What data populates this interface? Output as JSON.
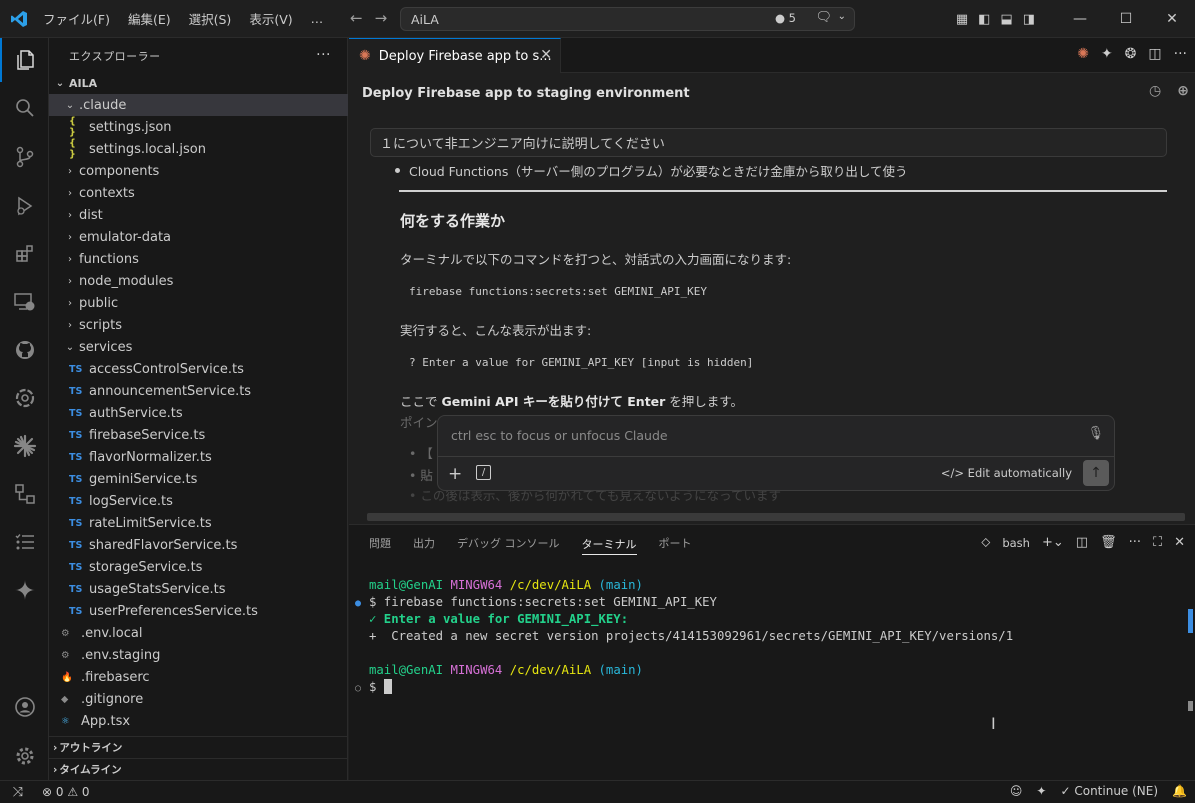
{
  "titlebar": {
    "menus": [
      "ファイル(F)",
      "編集(E)",
      "選択(S)",
      "表示(V)",
      "…"
    ],
    "search_text": "AiLA",
    "badge_count": "● 5"
  },
  "sidebar": {
    "header": "エクスプローラー",
    "root": "AILA",
    "items": [
      {
        "label": ".claude",
        "kind": "folder-open",
        "depth": 1,
        "selected": true
      },
      {
        "label": "settings.json",
        "kind": "json",
        "depth": 2
      },
      {
        "label": "settings.local.json",
        "kind": "json",
        "depth": 2
      },
      {
        "label": "components",
        "kind": "folder",
        "depth": 1
      },
      {
        "label": "contexts",
        "kind": "folder",
        "depth": 1
      },
      {
        "label": "dist",
        "kind": "folder",
        "depth": 1
      },
      {
        "label": "emulator-data",
        "kind": "folder",
        "depth": 1
      },
      {
        "label": "functions",
        "kind": "folder",
        "depth": 1
      },
      {
        "label": "node_modules",
        "kind": "folder",
        "depth": 1
      },
      {
        "label": "public",
        "kind": "folder",
        "depth": 1
      },
      {
        "label": "scripts",
        "kind": "folder",
        "depth": 1
      },
      {
        "label": "services",
        "kind": "folder-open",
        "depth": 1
      },
      {
        "label": "accessControlService.ts",
        "kind": "ts",
        "depth": 2
      },
      {
        "label": "announcementService.ts",
        "kind": "ts",
        "depth": 2
      },
      {
        "label": "authService.ts",
        "kind": "ts",
        "depth": 2
      },
      {
        "label": "firebaseService.ts",
        "kind": "ts",
        "depth": 2
      },
      {
        "label": "flavorNormalizer.ts",
        "kind": "ts",
        "depth": 2
      },
      {
        "label": "geminiService.ts",
        "kind": "ts",
        "depth": 2
      },
      {
        "label": "logService.ts",
        "kind": "ts",
        "depth": 2
      },
      {
        "label": "rateLimitService.ts",
        "kind": "ts",
        "depth": 2
      },
      {
        "label": "sharedFlavorService.ts",
        "kind": "ts",
        "depth": 2
      },
      {
        "label": "storageService.ts",
        "kind": "ts",
        "depth": 2
      },
      {
        "label": "usageStatsService.ts",
        "kind": "ts",
        "depth": 2
      },
      {
        "label": "userPreferencesService.ts",
        "kind": "ts",
        "depth": 2
      },
      {
        "label": ".env.local",
        "kind": "gear",
        "depth": 1
      },
      {
        "label": ".env.staging",
        "kind": "gear",
        "depth": 1
      },
      {
        "label": ".firebaserc",
        "kind": "fire",
        "depth": 1
      },
      {
        "label": ".gitignore",
        "kind": "git",
        "depth": 1
      },
      {
        "label": "App.tsx",
        "kind": "react",
        "depth": 1
      }
    ],
    "outline": "アウトライン",
    "timeline": "タイムライン"
  },
  "editor": {
    "tab_label": "Deploy Firebase app to s...",
    "panel_title": "Deploy Firebase app to staging environment",
    "question": "１について非エンジニア向けに説明してください",
    "bullet": "Cloud Functions（サーバー側のプログラム）が必要なときだけ金庫から取り出して使う",
    "heading": "何をする作業か",
    "para1": "ターミナルで以下のコマンドを打つと、対話式の入力画面になります:",
    "code1": "firebase functions:secrets:set GEMINI_API_KEY",
    "para2": "実行すると、こんな表示が出ます:",
    "code2": "? Enter a value for GEMINI_API_KEY [input is hidden]",
    "para3_pre": "ここで ",
    "para3_bold": "Gemini API キーを貼り付けて Enter",
    "para3_post": " を押します。",
    "faint1": "ポイン",
    "faint2": "• 【",
    "faint3": "• 貼",
    "faint4": "• この後は表示、後から何がれてても見えないようになっています",
    "input_placeholder": "ctrl esc to focus or unfocus Claude",
    "edit_mode": "Edit automatically"
  },
  "panel": {
    "tabs": [
      "問題",
      "出力",
      "デバッグ コンソール",
      "ターミナル",
      "ポート"
    ],
    "active_tab": "ターミナル",
    "shell": "bash",
    "terminal": {
      "prompt_user": "mail@GenAI",
      "prompt_env": "MINGW64",
      "prompt_path": "/c/dev/AiLA",
      "prompt_branch": "(main)",
      "cmd": "$ firebase functions:secrets:set GEMINI_API_KEY",
      "check_line": "✓ Enter a value for GEMINI_API_KEY:",
      "created_line": "+  Created a new secret version projects/414153092961/secrets/GEMINI_API_KEY/versions/1",
      "dollar": "$"
    }
  },
  "statusbar": {
    "errors": "⊗ 0 ⚠ 0",
    "continue": "Continue (NE)"
  }
}
